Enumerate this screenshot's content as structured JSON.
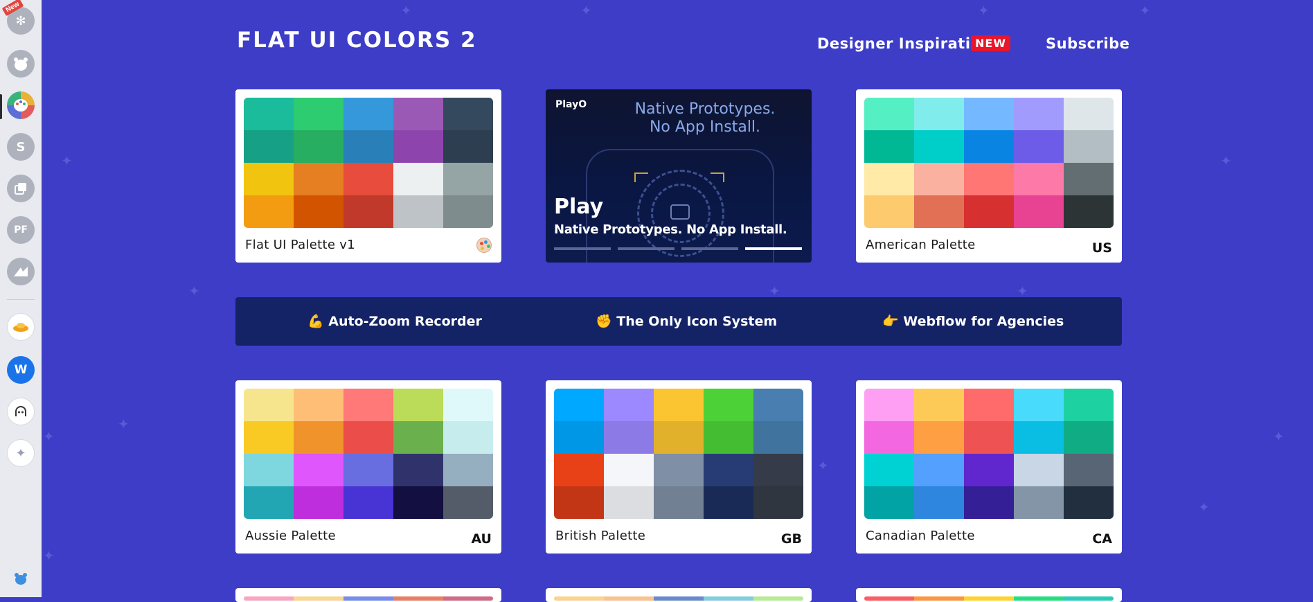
{
  "app_sidebar": {
    "items": [
      {
        "icon": "flower-app-icon",
        "badge": "New"
      },
      {
        "icon": "bear-app-icon"
      },
      {
        "icon": "palette-app-icon",
        "active": true
      },
      {
        "icon": "s-app-icon",
        "glyph": "S"
      },
      {
        "icon": "layers-app-icon"
      },
      {
        "icon": "pf-app-icon",
        "glyph": "PF"
      },
      {
        "icon": "mountain-app-icon"
      },
      {
        "icon": "cloud-app-icon"
      },
      {
        "icon": "webflow-app-icon",
        "glyph": "W"
      },
      {
        "icon": "robot-app-icon"
      },
      {
        "icon": "sparkle-add-icon"
      }
    ],
    "footer_icon": "bear-footer-icon"
  },
  "header": {
    "title": "FLAT UI COLORS 2",
    "nav": [
      {
        "label": "Designer Inspiration",
        "badge": "NEW"
      },
      {
        "label": "Subscribe"
      }
    ]
  },
  "ad": {
    "logo": "PlayO",
    "headline_line1": "Native Prototypes.",
    "headline_line2": "No App Install.",
    "title": "Play",
    "subtitle": "Native Prototypes. No App Install.",
    "slide_index": 4,
    "slide_count": 4
  },
  "sponsors": [
    {
      "emoji": "💪",
      "label": "Auto-Zoom Recorder"
    },
    {
      "emoji": "✊",
      "label": "The Only Icon System"
    },
    {
      "emoji": "👉",
      "label": "Webflow for Agencies"
    }
  ],
  "palettes": [
    {
      "name": "Flat UI Palette v1",
      "code": "",
      "icon": "palette-emoji-icon",
      "colors": [
        "#1abc9c",
        "#2ecc71",
        "#3498db",
        "#9b59b6",
        "#34495e",
        "#16a085",
        "#27ae60",
        "#2980b9",
        "#8e44ad",
        "#2c3e50",
        "#f1c40f",
        "#e67e22",
        "#e74c3c",
        "#ecf0f1",
        "#95a5a6",
        "#f39c12",
        "#d35400",
        "#c0392b",
        "#bdc3c7",
        "#7f8c8d"
      ]
    },
    {
      "name": "American Palette",
      "code": "US",
      "colors": [
        "#55efc4",
        "#81ecec",
        "#74b9ff",
        "#a29bfe",
        "#dfe6e9",
        "#00b894",
        "#00cec9",
        "#0984e3",
        "#6c5ce7",
        "#b2bec3",
        "#ffeaa7",
        "#fab1a0",
        "#ff7675",
        "#fd79a8",
        "#636e72",
        "#fdcb6e",
        "#e17055",
        "#d63031",
        "#e84393",
        "#2d3436"
      ]
    },
    {
      "name": "Aussie Palette",
      "code": "AU",
      "colors": [
        "#f6e58d",
        "#ffbe76",
        "#ff7979",
        "#badc58",
        "#dff9fb",
        "#f9ca24",
        "#f0932b",
        "#eb4d4b",
        "#6ab04c",
        "#c7ecee",
        "#7ed6df",
        "#e056fd",
        "#686de0",
        "#30336b",
        "#95afc0",
        "#22a6b3",
        "#be2edd",
        "#4834d4",
        "#130f40",
        "#535c68"
      ]
    },
    {
      "name": "British Palette",
      "code": "GB",
      "colors": [
        "#00a8ff",
        "#9c88ff",
        "#fbc531",
        "#4cd137",
        "#487eb0",
        "#0097e6",
        "#8c7ae6",
        "#e1b12c",
        "#44bd32",
        "#40739e",
        "#e84118",
        "#f5f6fa",
        "#7f8fa6",
        "#273c75",
        "#353b48",
        "#c23616",
        "#dcdde1",
        "#718093",
        "#192a56",
        "#2f3640"
      ]
    },
    {
      "name": "Canadian Palette",
      "code": "CA",
      "colors": [
        "#ff9ff3",
        "#feca57",
        "#ff6b6b",
        "#48dbfb",
        "#1dd1a1",
        "#f368e0",
        "#ff9f43",
        "#ee5253",
        "#0abde3",
        "#10ac84",
        "#00d2d3",
        "#54a0ff",
        "#5f27cd",
        "#c8d6e5",
        "#576574",
        "#01a3a4",
        "#2e86de",
        "#341f97",
        "#8395a7",
        "#222f3e"
      ]
    }
  ],
  "partial_row": [
    {
      "colors": [
        "#f8a5c2",
        "#f7d794",
        "#778beb",
        "#e77f67",
        "#cf6a87"
      ]
    },
    {
      "colors": [
        "#fad390",
        "#f8c291",
        "#6a89cc",
        "#82ccdd",
        "#b8e994"
      ]
    },
    {
      "colors": [
        "#fc5c65",
        "#fd9644",
        "#fed330",
        "#26de81",
        "#2bcbba"
      ]
    }
  ],
  "colors": {
    "background": "#3d3dc8",
    "sponsor_bar": "#142365",
    "new_badge": "#e8152b"
  }
}
